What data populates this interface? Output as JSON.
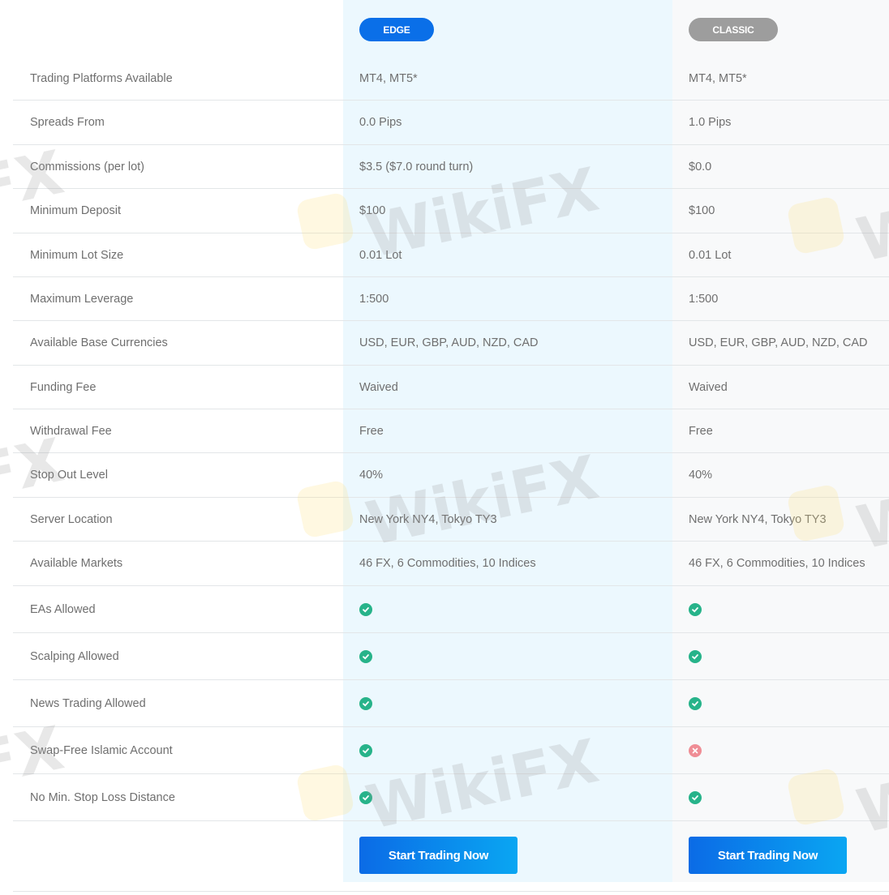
{
  "plans": [
    {
      "name": "EDGE",
      "color": "#0a6fe8"
    },
    {
      "name": "CLASSIC",
      "color": "#9d9d9d"
    }
  ],
  "rows": [
    {
      "label": "Trading Platforms Available",
      "edge": "MT4, MT5*",
      "classic": "MT4, MT5*"
    },
    {
      "label": "Spreads From",
      "edge": "0.0 Pips",
      "classic": "1.0 Pips"
    },
    {
      "label": "Commissions (per lot)",
      "edge": "$3.5 ($7.0 round turn)",
      "classic": "$0.0"
    },
    {
      "label": "Minimum Deposit",
      "edge": "$100",
      "classic": "$100"
    },
    {
      "label": "Minimum Lot Size",
      "edge": "0.01 Lot",
      "classic": "0.01 Lot"
    },
    {
      "label": "Maximum Leverage",
      "edge": "1:500",
      "classic": "1:500"
    },
    {
      "label": "Available Base Currencies",
      "edge": "USD, EUR, GBP, AUD, NZD, CAD",
      "classic": "USD, EUR, GBP, AUD, NZD, CAD"
    },
    {
      "label": "Funding Fee",
      "edge": "Waived",
      "classic": "Waived"
    },
    {
      "label": "Withdrawal Fee",
      "edge": "Free",
      "classic": "Free"
    },
    {
      "label": "Stop Out Level",
      "edge": "40%",
      "classic": "40%"
    },
    {
      "label": "Server Location",
      "edge": "New York NY4, Tokyo TY3",
      "classic": "New York NY4, Tokyo TY3"
    },
    {
      "label": "Available Markets",
      "edge": "46 FX, 6 Commodities, 10 Indices",
      "classic": "46 FX, 6 Commodities, 10 Indices"
    }
  ],
  "feature_rows": [
    {
      "label": "EAs Allowed",
      "edge": true,
      "classic": true
    },
    {
      "label": "Scalping Allowed",
      "edge": true,
      "classic": true
    },
    {
      "label": "News Trading Allowed",
      "edge": true,
      "classic": true
    },
    {
      "label": "Swap-Free Islamic Account",
      "edge": true,
      "classic": false
    },
    {
      "label": "No Min. Stop Loss Distance",
      "edge": true,
      "classic": true
    }
  ],
  "cta": {
    "edge_label": "Start Trading Now",
    "classic_label": "Start Trading Now"
  },
  "watermark": {
    "text": "WikiFX"
  },
  "colors": {
    "check": "#27b38a",
    "cross": "#ef8d95",
    "edge_bg": "#ecf8fe",
    "classic_bg": "#f8f9fa"
  }
}
